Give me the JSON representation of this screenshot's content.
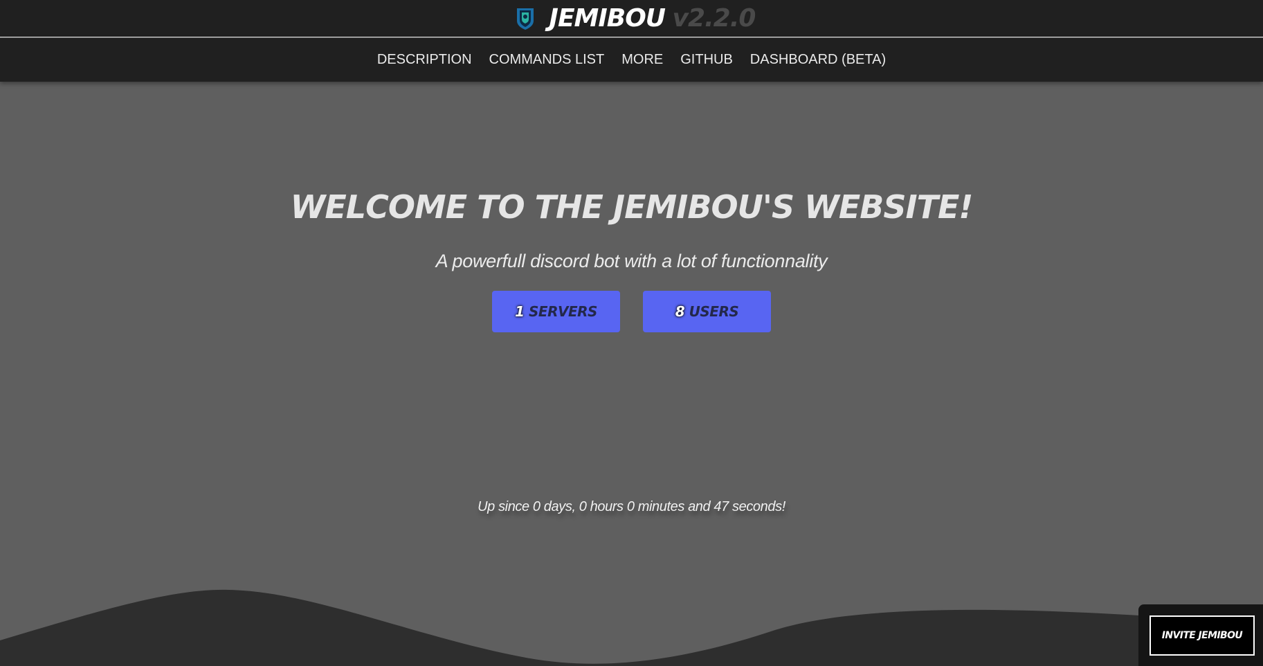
{
  "header": {
    "brand_name": "JEMIBOU",
    "version": "v2.2.0",
    "logo_icon": "shield-icon"
  },
  "nav": {
    "items": [
      {
        "label": "DESCRIPTION"
      },
      {
        "label": "COMMANDS LIST"
      },
      {
        "label": "MORE"
      },
      {
        "label": "GITHUB"
      },
      {
        "label": "DASHBOARD (BETA)"
      }
    ]
  },
  "hero": {
    "title": "WELCOME TO THE JEMIBOU'S WEBSITE!",
    "subtitle": "A powerfull discord bot with a lot of functionnality"
  },
  "stats": {
    "servers": {
      "count": "1",
      "label": "SERVERS"
    },
    "users": {
      "count": "8",
      "label": "USERS"
    }
  },
  "uptime": {
    "text": "Up since 0 days, 0 hours 0 minutes and 47 seconds!"
  },
  "invite": {
    "label": "INVITE JEMIBOU"
  },
  "colors": {
    "background": "#5f5f5f",
    "navbar": "#202020",
    "accent": "#5865f2",
    "wave": "#2e2e2e"
  }
}
